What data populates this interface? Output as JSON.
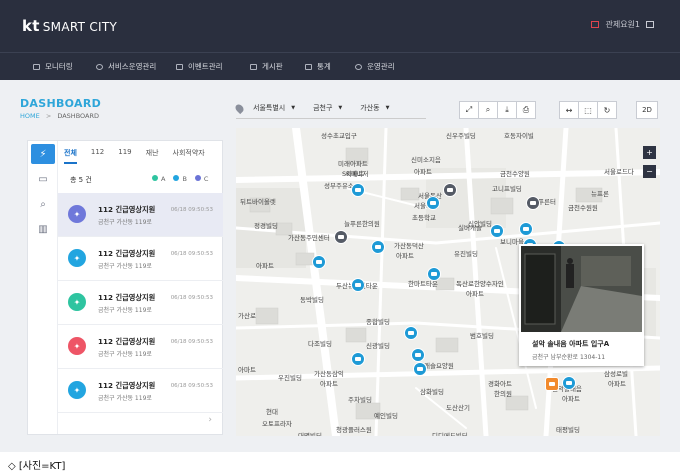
{
  "header": {
    "logo_kt": "kt",
    "logo_text": "SMART CITY",
    "user": "관제요원1",
    "nav": [
      "모니터링",
      "서비스운영관리",
      "이벤트관리",
      "게시판",
      "통계",
      "운영관리"
    ]
  },
  "breadcrumb": {
    "title": "DASHBOARD",
    "home": "HOME",
    "sep": ">",
    "current": "DASHBOARD"
  },
  "panel": {
    "tabs": [
      "전체",
      "112",
      "119",
      "재난",
      "사회적약자"
    ],
    "count": "총 5 건",
    "legend": [
      {
        "label": "A",
        "color": "#2ec4a0"
      },
      {
        "label": "B",
        "color": "#22a5e0"
      },
      {
        "label": "C",
        "color": "#6b73d6"
      }
    ],
    "items": [
      {
        "title": "112 긴급영상지원",
        "sub": "금천구 가산동 119로",
        "time": "06/18 09:50:53",
        "color": "#6f78da"
      },
      {
        "title": "112 긴급영상지원",
        "sub": "금천구 가산동 119로",
        "time": "06/18 09:50:53",
        "color": "#22a5e0"
      },
      {
        "title": "112 긴급영상지원",
        "sub": "금천구 가산동 119로",
        "time": "06/18 09:50:53",
        "color": "#2ec4a0"
      },
      {
        "title": "112 긴급영상지원",
        "sub": "금천구 가산동 119로",
        "time": "06/18 09:50:53",
        "color": "#ee5566"
      },
      {
        "title": "112 긴급영상지원",
        "sub": "금천구 가산동 119로",
        "time": "06/18 09:50:53",
        "color": "#22a5e0"
      }
    ]
  },
  "filters": {
    "city": "서울특별시",
    "district": "금천구",
    "dong": "가산동"
  },
  "map": {
    "view_button": "2D",
    "labels": [
      "성수초교입구",
      "신우주빌딩",
      "호동자이빌",
      "미래아파트",
      "신미소지음",
      "SK매니저",
      "성부주유소",
      "아파트",
      "아파트",
      "금천수양원",
      "서울독산",
      "서울로드다",
      "뉴프론",
      "고니프빌딩",
      "뒤트바이올렛",
      "정경빌딩",
      "서울가산",
      "초등학교",
      "신안빌딩",
      "실버캐슬",
      "늘푸른한의원",
      "푸른터",
      "금천수원원",
      "가산동주민센터",
      "가산동덕산",
      "아파트",
      "유진빌딩",
      "보니마을",
      "국태빌딩",
      "동부센트레빌",
      "아파트",
      "두산뉴그린타운",
      "한마트타운",
      "독산로한양수자인",
      "아파트",
      "종합빌딩",
      "벽트리움",
      "아파트",
      "동박빌딩",
      "가산로",
      "범호빌딩",
      "다조빌딩",
      "신광빌딩",
      "가산동삼익",
      "아파트",
      "우진빌딩",
      "아마트",
      "버캐슬요양원",
      "삼화빌딩",
      "주차빌딩",
      "경화아트",
      "한의원",
      "설악솔내음",
      "아파트",
      "삼성로빌",
      "아파트",
      "예인빌딩",
      "현대",
      "오토프라자",
      "도산산기",
      "대명빌딩",
      "청광플러스원",
      "디디메드빌딩",
      "태평빌딩"
    ]
  },
  "popup": {
    "title": "설악 솔내음 아파트 입구A",
    "address": "금천구 남부순환로 1304-11"
  },
  "caption": "◇ [사진=KT]"
}
